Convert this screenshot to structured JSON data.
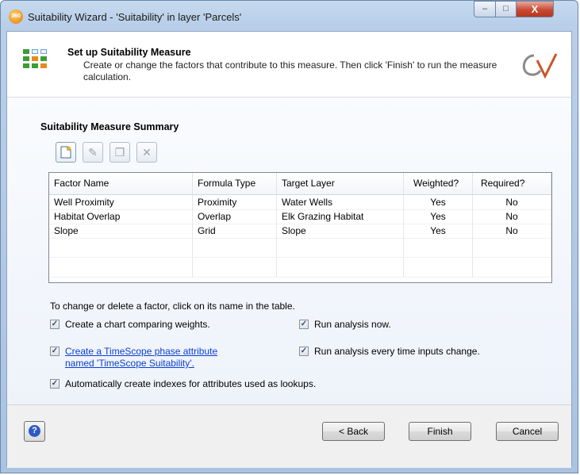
{
  "window": {
    "title": "Suitability Wizard - 'Suitability' in layer 'Parcels'",
    "app_icon": "360",
    "minimize_label": "–",
    "maximize_label": "□",
    "close_label": "X"
  },
  "header": {
    "title": "Set up Suitability Measure",
    "description": "Create or change the factors that contribute to this measure.  Then click 'Finish' to run the measure calculation."
  },
  "summary": {
    "title": "Suitability Measure Summary",
    "toolbar": [
      {
        "name": "new-factor-icon",
        "glyph": "✧"
      },
      {
        "name": "edit-factor-icon",
        "glyph": "✎"
      },
      {
        "name": "copy-factor-icon",
        "glyph": "❐"
      },
      {
        "name": "delete-factor-icon",
        "glyph": "✕"
      }
    ],
    "columns": [
      "Factor Name",
      "Formula Type",
      "Target Layer",
      "Weighted?",
      "Required?"
    ],
    "rows": [
      [
        "Well Proximity",
        "Proximity",
        "Water Wells",
        "Yes",
        "No"
      ],
      [
        "Habitat Overlap",
        "Overlap",
        "Elk Grazing Habitat",
        "Yes",
        "No"
      ],
      [
        "Slope",
        "Grid",
        "Slope",
        "Yes",
        "No"
      ]
    ],
    "hint": "To change or delete a factor, click on its name in the table."
  },
  "options": {
    "chart": {
      "label": "Create a chart comparing weights.",
      "checked": true
    },
    "run_now": {
      "label": "Run analysis now.",
      "checked": true
    },
    "timescope": {
      "label_line1": "Create a TimeScope phase attribute",
      "label_line2": "named 'TimeScope Suitability'.",
      "checked": true
    },
    "run_every": {
      "label": "Run analysis every time inputs change.",
      "checked": true
    },
    "indexes": {
      "label": "Automatically create indexes for attributes used as lookups.",
      "checked": true
    }
  },
  "footer": {
    "help_label": "?",
    "back_label": "< Back",
    "finish_label": "Finish",
    "cancel_label": "Cancel"
  }
}
